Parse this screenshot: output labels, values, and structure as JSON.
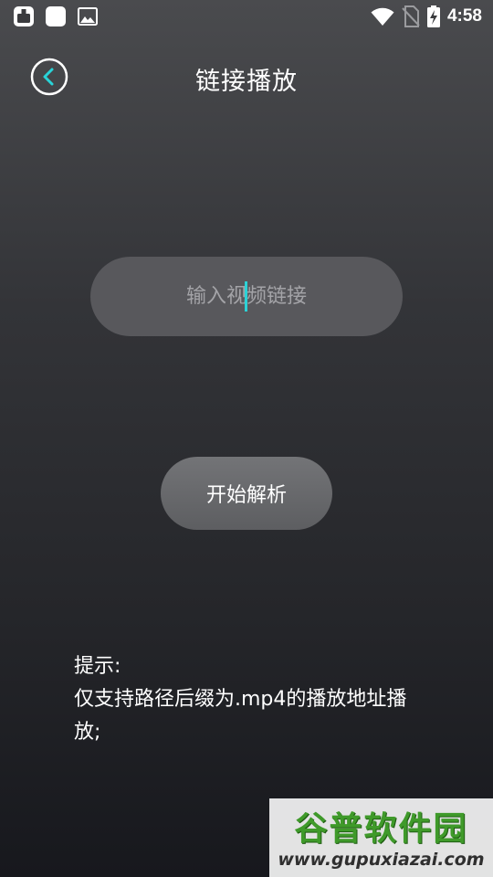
{
  "status_bar": {
    "time": "4:58",
    "left_icons": [
      "notification-app-icon",
      "notification-square-icon",
      "image-icon"
    ],
    "right_icons": [
      "wifi-icon",
      "no-sim-icon",
      "battery-charging-icon"
    ]
  },
  "header": {
    "title": "链接播放",
    "back_icon": "chevron-left-circle-icon"
  },
  "url_input": {
    "placeholder": "输入视频链接",
    "value": ""
  },
  "parse_button": {
    "label": "开始解析"
  },
  "hint": {
    "title": "提示:",
    "body": "仅支持路径后缀为.mp4的播放地址播放;"
  },
  "watermark": {
    "logo_text": "谷普软件园",
    "url": "www.gupuxiazai.com"
  },
  "colors": {
    "accent": "#29d3d8",
    "input_bg": "#58585c",
    "button_bg": "#6a6b6e",
    "background_top": "#4a4b4e",
    "background_bottom": "#17181d",
    "watermark_green": "#3f9a2a"
  }
}
